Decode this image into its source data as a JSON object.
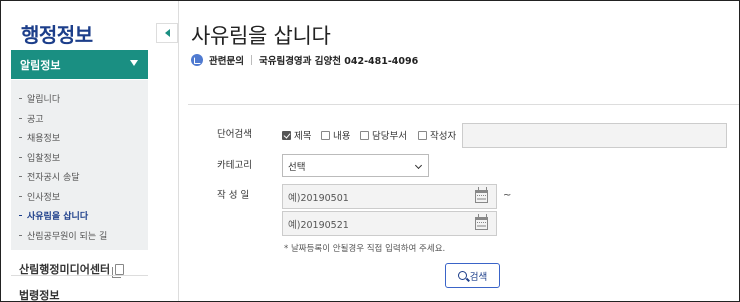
{
  "sidebar": {
    "title": "행정정보",
    "menu_head": "알림정보",
    "items": [
      {
        "label": "알립니다"
      },
      {
        "label": "공고"
      },
      {
        "label": "채용정보"
      },
      {
        "label": "입찰정보"
      },
      {
        "label": "전자공시 송달"
      },
      {
        "label": "인사정보"
      },
      {
        "label": "사유림을 삽니다"
      },
      {
        "label": "산림공무원이 되는 길"
      }
    ],
    "active_item": "사유림을 삽니다",
    "media_center": "산림행정미디어센터",
    "law_info": "법령정보"
  },
  "page": {
    "title": "사유림을 삽니다",
    "contact_label": "관련문의",
    "contact_value": "국유림경영과 김양천 042-481-4096"
  },
  "search_form": {
    "word_label": "단어검색",
    "checkboxes": [
      {
        "label": "제목",
        "checked": true
      },
      {
        "label": "내용",
        "checked": false
      },
      {
        "label": "담당부서",
        "checked": false
      },
      {
        "label": "작성자",
        "checked": false
      }
    ],
    "keyword_value": "",
    "category_label": "카테고리",
    "category_selected": "선택",
    "date_label": "작 성 일",
    "date_from_placeholder": "예)20190501",
    "date_to_placeholder": "예)20190521",
    "tilde": "~",
    "note": "* 날짜등록이 안될경우 직접 입력하여 주세요.",
    "search_button": "검색"
  },
  "colors": {
    "brand_blue": "#1c3e8a",
    "menu_green": "#1a8f82",
    "submenu_bg": "#eef0f1"
  },
  "icons": [
    "chevron-down-icon",
    "collapse-arrow-icon",
    "phone-icon",
    "copy-icon",
    "calendar-icon",
    "search-icon",
    "checkbox-icon"
  ]
}
